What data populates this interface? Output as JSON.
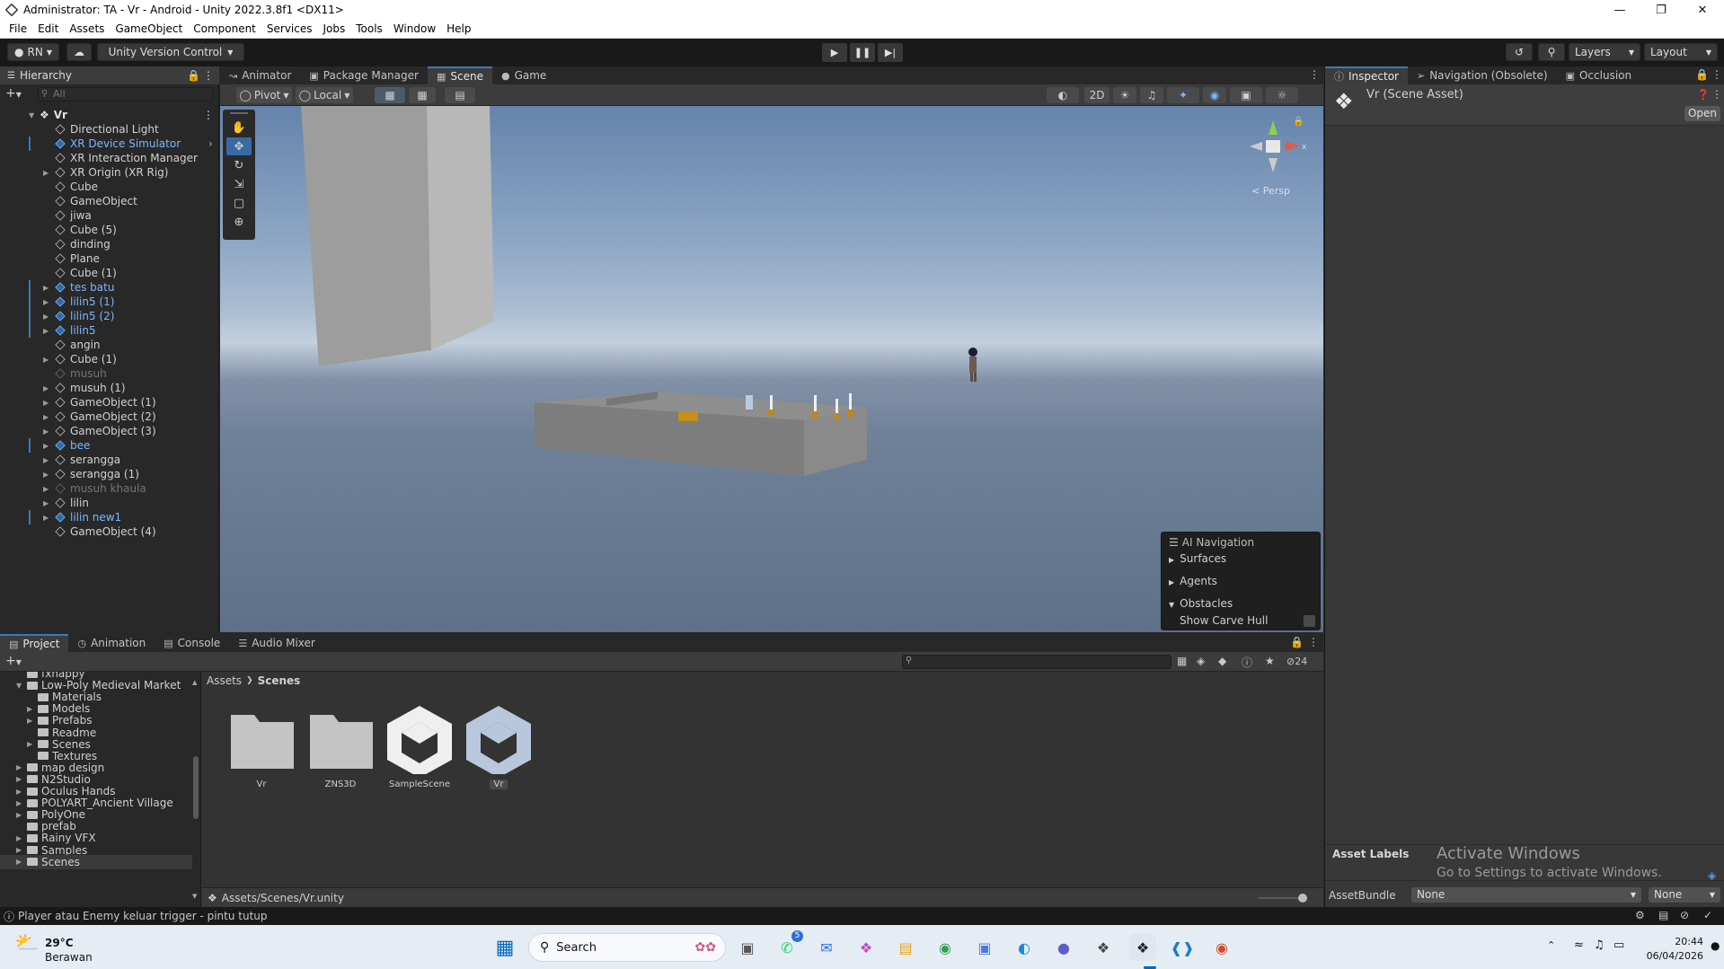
{
  "window": {
    "title": "Administrator: TA - Vr - Android - Unity 2022.3.8f1 <DX11>"
  },
  "menu": [
    "File",
    "Edit",
    "Assets",
    "GameObject",
    "Component",
    "Services",
    "Jobs",
    "Tools",
    "Window",
    "Help"
  ],
  "toolbar": {
    "account": "RN",
    "version_control": "Unity Version Control",
    "layers": "Layers",
    "layout": "Layout"
  },
  "hierarchy": {
    "tab": "Hierarchy",
    "search_placeholder": "All",
    "root": "Vr",
    "items": [
      {
        "label": "Directional Light",
        "type": "normal",
        "arrow": false
      },
      {
        "label": "XR Device Simulator",
        "type": "prefab",
        "arrow": false
      },
      {
        "label": "XR Interaction Manager",
        "type": "normal",
        "arrow": false
      },
      {
        "label": "XR Origin (XR Rig)",
        "type": "normal",
        "arrow": true
      },
      {
        "label": "Cube",
        "type": "normal",
        "arrow": false
      },
      {
        "label": "GameObject",
        "type": "normal",
        "arrow": false
      },
      {
        "label": "jiwa",
        "type": "normal",
        "arrow": false
      },
      {
        "label": "Cube (5)",
        "type": "normal",
        "arrow": false
      },
      {
        "label": "dinding",
        "type": "normal",
        "arrow": false
      },
      {
        "label": "Plane",
        "type": "normal",
        "arrow": false
      },
      {
        "label": "Cube (1)",
        "type": "normal",
        "arrow": false
      },
      {
        "label": "tes batu",
        "type": "prefab",
        "arrow": true
      },
      {
        "label": "lilin5 (1)",
        "type": "prefab",
        "arrow": true
      },
      {
        "label": "lilin5 (2)",
        "type": "prefab",
        "arrow": true
      },
      {
        "label": "lilin5",
        "type": "prefab",
        "arrow": true
      },
      {
        "label": "angin",
        "type": "normal",
        "arrow": false
      },
      {
        "label": "Cube (1)",
        "type": "normal",
        "arrow": true
      },
      {
        "label": "musuh",
        "type": "disabled",
        "arrow": false
      },
      {
        "label": "musuh (1)",
        "type": "normal",
        "arrow": true
      },
      {
        "label": "GameObject (1)",
        "type": "normal",
        "arrow": true
      },
      {
        "label": "GameObject (2)",
        "type": "normal",
        "arrow": true
      },
      {
        "label": "GameObject (3)",
        "type": "normal",
        "arrow": true
      },
      {
        "label": "bee",
        "type": "prefab",
        "arrow": true
      },
      {
        "label": "serangga",
        "type": "normal",
        "arrow": true
      },
      {
        "label": "serangga (1)",
        "type": "normal",
        "arrow": true
      },
      {
        "label": "musuh khaula",
        "type": "disabled",
        "arrow": true
      },
      {
        "label": "lilin",
        "type": "normal",
        "arrow": true
      },
      {
        "label": "lilin new1",
        "type": "prefab",
        "arrow": true
      },
      {
        "label": "GameObject (4)",
        "type": "normal",
        "arrow": false
      }
    ]
  },
  "scene_tabs": [
    {
      "label": "Animator",
      "icon": "animator-icon",
      "active": false
    },
    {
      "label": "Package Manager",
      "icon": "package-icon",
      "active": false
    },
    {
      "label": "Scene",
      "icon": "scene-icon",
      "active": true
    },
    {
      "label": "Game",
      "icon": "game-icon",
      "active": false
    }
  ],
  "scene_toolbar": {
    "pivot": "Pivot",
    "local": "Local",
    "mode_2d": "2D"
  },
  "gizmo": {
    "projection": "Persp",
    "axis_y": "y",
    "axis_x": "x"
  },
  "ai_navigation": {
    "title": "AI Navigation",
    "sections": [
      "Surfaces",
      "Agents",
      "Obstacles"
    ],
    "option": "Show Carve Hull"
  },
  "inspector": {
    "tabs": [
      {
        "label": "Inspector",
        "active": true
      },
      {
        "label": "Navigation (Obsolete)",
        "active": false
      },
      {
        "label": "Occlusion",
        "active": false
      }
    ],
    "asset_title": "Vr (Scene Asset)",
    "open_button": "Open",
    "asset_labels": "Asset Labels",
    "asset_bundle_label": "AssetBundle",
    "asset_bundle_value": "None",
    "asset_bundle_variant": "None",
    "activate_title": "Activate Windows",
    "activate_sub": "Go to Settings to activate Windows."
  },
  "project_tabs": [
    {
      "label": "Project",
      "active": true
    },
    {
      "label": "Animation",
      "active": false
    },
    {
      "label": "Console",
      "active": false
    },
    {
      "label": "Audio Mixer",
      "active": false
    }
  ],
  "project": {
    "hidden_count": "24",
    "tree": [
      {
        "label": "fxhappy",
        "indent": 1,
        "arrow": false,
        "open": false
      },
      {
        "label": "Low-Poly Medieval Market",
        "indent": 1,
        "arrow": true,
        "open": true
      },
      {
        "label": "Materials",
        "indent": 2,
        "arrow": false,
        "open": false
      },
      {
        "label": "Models",
        "indent": 2,
        "arrow": true,
        "open": false
      },
      {
        "label": "Prefabs",
        "indent": 2,
        "arrow": true,
        "open": false
      },
      {
        "label": "Readme",
        "indent": 2,
        "arrow": false,
        "open": false
      },
      {
        "label": "Scenes",
        "indent": 2,
        "arrow": true,
        "open": false
      },
      {
        "label": "Textures",
        "indent": 2,
        "arrow": false,
        "open": false
      },
      {
        "label": "map design",
        "indent": 1,
        "arrow": true,
        "open": false
      },
      {
        "label": "N2Studio",
        "indent": 1,
        "arrow": true,
        "open": false
      },
      {
        "label": "Oculus Hands",
        "indent": 1,
        "arrow": true,
        "open": false
      },
      {
        "label": "POLYART_Ancient Village",
        "indent": 1,
        "arrow": true,
        "open": false
      },
      {
        "label": "PolyOne",
        "indent": 1,
        "arrow": true,
        "open": false
      },
      {
        "label": "prefab",
        "indent": 1,
        "arrow": false,
        "open": false
      },
      {
        "label": "Rainy VFX",
        "indent": 1,
        "arrow": true,
        "open": false
      },
      {
        "label": "Samples",
        "indent": 1,
        "arrow": true,
        "open": false
      },
      {
        "label": "Scenes",
        "indent": 1,
        "arrow": true,
        "open": false
      }
    ],
    "breadcrumb": [
      "Assets",
      "Scenes"
    ],
    "assets": [
      {
        "label": "Vr",
        "kind": "folder"
      },
      {
        "label": "ZNS3D",
        "kind": "folder"
      },
      {
        "label": "SampleScene",
        "kind": "scene"
      },
      {
        "label": "Vr",
        "kind": "scene-selected"
      }
    ],
    "path": "Assets/Scenes/Vr.unity"
  },
  "status": {
    "message": "Player atau Enemy keluar trigger - pintu tutup"
  },
  "taskbar": {
    "weather_temp": "29°C",
    "weather_desc": "Berawan",
    "search_label": "Search",
    "time": "20:44",
    "date": "06/04/2026",
    "whatsapp_badge": "5"
  },
  "colors": {
    "accent": "#3a79bb",
    "prefab": "#7ab7ff"
  }
}
